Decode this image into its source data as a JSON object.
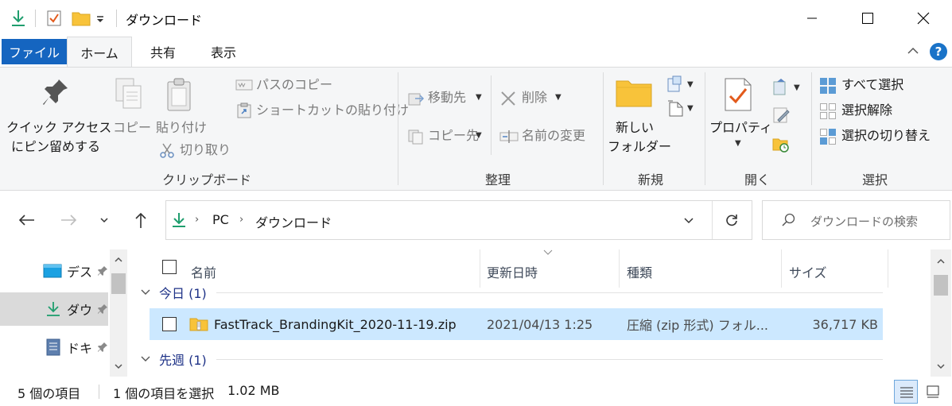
{
  "window": {
    "title": "ダウンロード",
    "accent": "#1565c0"
  },
  "tabs": [
    {
      "label": "ファイル"
    },
    {
      "label": "ホーム"
    },
    {
      "label": "共有"
    },
    {
      "label": "表示"
    }
  ],
  "ribbon": {
    "clipboard": {
      "pin_line1": "クイック アクセス",
      "pin_line2": "にピン留めする",
      "copy": "コピー",
      "paste": "貼り付け",
      "copy_path": "パスのコピー",
      "paste_shortcut": "ショートカットの貼り付け",
      "cut": "切り取り",
      "group": "クリップボード"
    },
    "organize": {
      "move_to": "移動先",
      "copy_to": "コピー先",
      "delete": "削除",
      "rename": "名前の変更",
      "group": "整理"
    },
    "new": {
      "new_folder_line1": "新しい",
      "new_folder_line2": "フォルダー",
      "group": "新規"
    },
    "open": {
      "properties": "プロパティ",
      "group": "開く"
    },
    "select": {
      "select_all": "すべて選択",
      "select_none": "選択解除",
      "invert": "選択の切り替え",
      "group": "選択"
    }
  },
  "address": {
    "crumbs": [
      "PC",
      "ダウンロード"
    ],
    "search_placeholder": "ダウンロードの検索"
  },
  "nav": {
    "items": [
      {
        "label": "デス"
      },
      {
        "label": "ダウ"
      },
      {
        "label": "ドキ"
      }
    ]
  },
  "filelist": {
    "columns": {
      "name": "名前",
      "modified": "更新日時",
      "type": "種類",
      "size": "サイズ"
    },
    "groups": [
      {
        "label": "今日 (1)"
      },
      {
        "label": "先週 (1)"
      }
    ],
    "rows": [
      {
        "name": "FastTrack_BrandingKit_2020-11-19.zip",
        "modified": "2021/04/13 1:25",
        "type": "圧縮 (zip 形式) フォル...",
        "size": "36,717 KB"
      }
    ]
  },
  "status": {
    "count": "5 個の項目",
    "selected": "1 個の項目を選択",
    "selected_size": "1.02 MB"
  }
}
